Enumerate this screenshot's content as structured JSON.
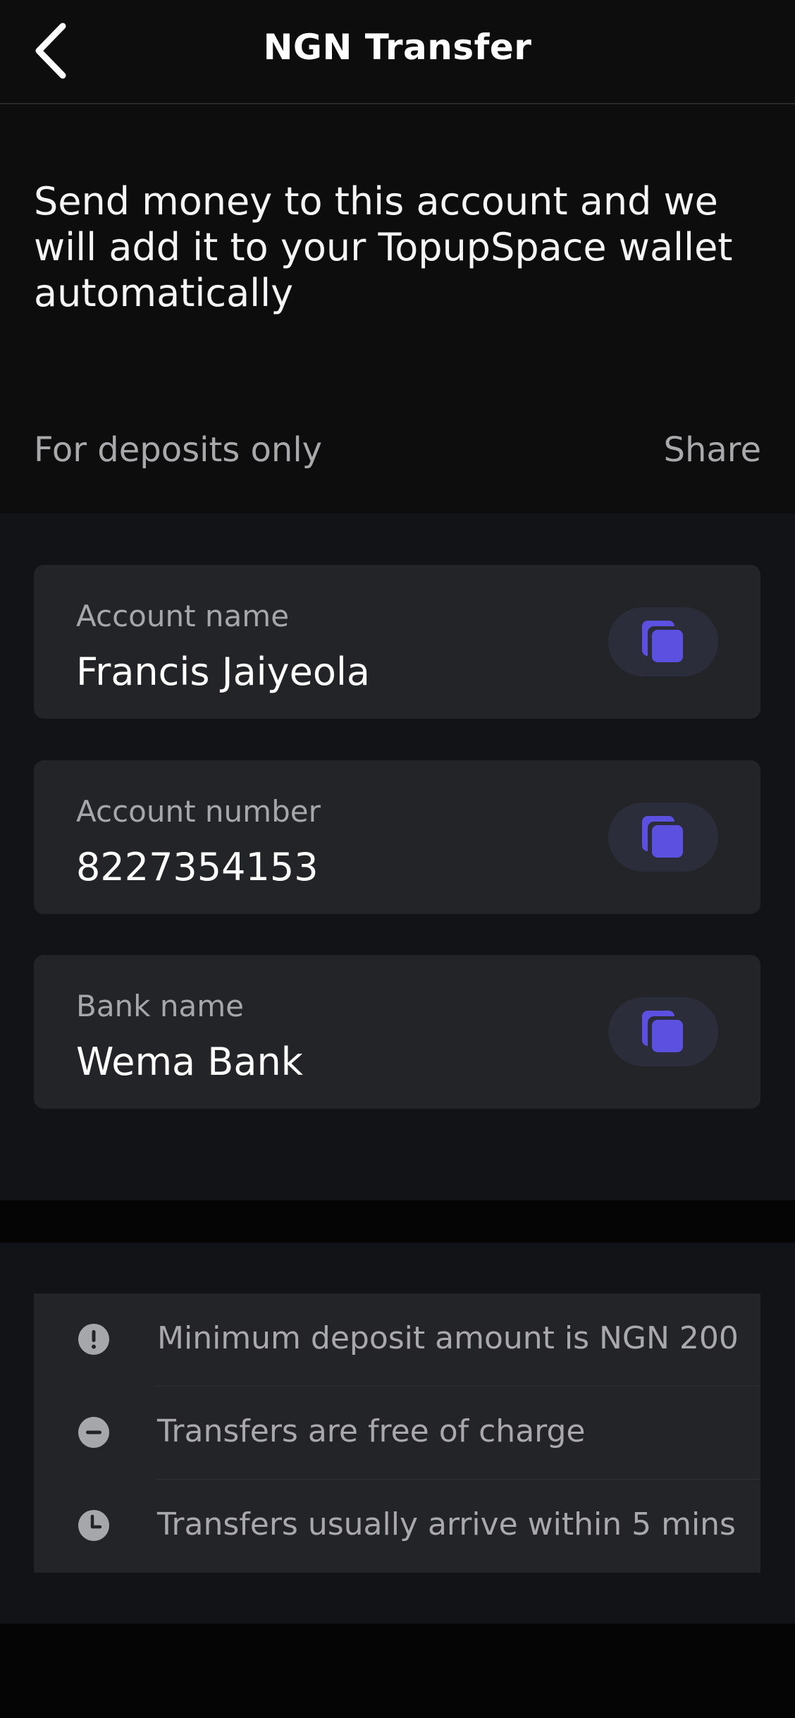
{
  "header": {
    "title": "NGN Transfer",
    "back_icon": "chevron-left-icon"
  },
  "intro": {
    "text": "Send money to this account and we will add it to your TopupSpace wallet automatically",
    "deposits_label": "For deposits only",
    "share_label": "Share"
  },
  "account": {
    "fields": [
      {
        "label": "Account name",
        "value": "Francis Jaiyeola",
        "icon": "copy-icon"
      },
      {
        "label": "Account number",
        "value": "8227354153",
        "icon": "copy-icon"
      },
      {
        "label": "Bank name",
        "value": "Wema Bank",
        "icon": "copy-icon"
      }
    ]
  },
  "info": {
    "items": [
      {
        "text": "Minimum deposit amount is NGN 200",
        "icon": "exclamation-icon"
      },
      {
        "text": "Transfers are free of charge",
        "icon": "minus-icon"
      },
      {
        "text": "Transfers usually arrive within 5 mins",
        "icon": "clock-icon"
      }
    ]
  },
  "colors": {
    "accent": "#5b50e0",
    "background": "#050505",
    "card": "#232428",
    "muted_text": "#a9a9ab"
  }
}
